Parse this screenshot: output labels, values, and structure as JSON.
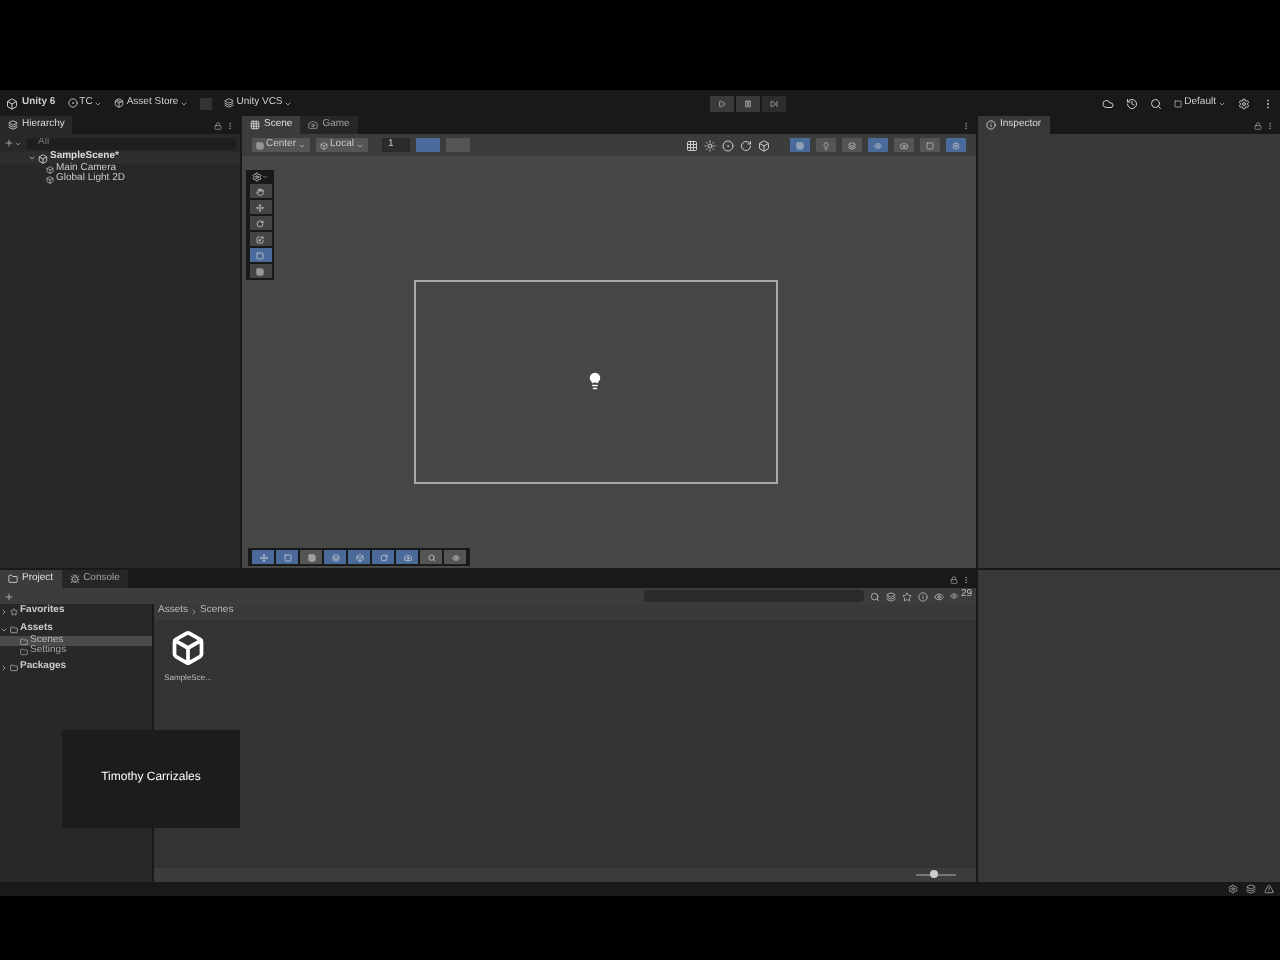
{
  "toolbar": {
    "account": "Unity 6",
    "cloud": "TC",
    "asset_store": "Asset Store",
    "vcs": "Unity VCS",
    "layout": "Default"
  },
  "hierarchy": {
    "tab": "Hierarchy",
    "search_placeholder": "All",
    "scene": {
      "name": "SampleScene*",
      "expanded": true,
      "children": [
        {
          "name": "Main Camera"
        },
        {
          "name": "Global Light 2D"
        }
      ]
    }
  },
  "scene_view": {
    "tabs": [
      {
        "label": "Scene",
        "selected": true
      },
      {
        "label": "Game",
        "selected": false
      }
    ],
    "pivot": "Center",
    "space": "Local",
    "grid_value": "1",
    "grid_toggle": {
      "on": true
    },
    "snap_toggle": {
      "on": false
    },
    "view_toggles": [
      {
        "on": true
      },
      {
        "on": false
      },
      {
        "on": false
      },
      {
        "on": true
      },
      {
        "on": false
      },
      {
        "on": false
      },
      {
        "on": true
      }
    ],
    "tools": [
      {
        "selected": false
      },
      {
        "selected": false
      },
      {
        "selected": false
      },
      {
        "selected": false
      },
      {
        "selected": true
      },
      {
        "selected": false
      }
    ],
    "overlay_tools": [
      {
        "selected": true
      },
      {
        "selected": true
      },
      {
        "selected": false
      },
      {
        "selected": true
      },
      {
        "selected": true
      },
      {
        "selected": true
      },
      {
        "selected": true
      },
      {
        "selected": false
      },
      {
        "selected": false
      }
    ]
  },
  "inspector": {
    "tab": "Inspector"
  },
  "project": {
    "tabs": [
      {
        "label": "Project",
        "selected": true
      },
      {
        "label": "Console",
        "selected": false
      }
    ],
    "tree": [
      {
        "name": "Favorites",
        "expanded": false,
        "selected": false
      },
      {
        "name": "Assets",
        "expanded": true,
        "selected": false,
        "children": [
          {
            "name": "Scenes",
            "selected": true
          },
          {
            "name": "Settings",
            "selected": false
          }
        ]
      },
      {
        "name": "Packages",
        "expanded": false,
        "selected": false
      }
    ],
    "breadcrumb": [
      "Assets",
      "Scenes"
    ],
    "items": [
      {
        "name": "SampleSce..."
      }
    ],
    "hidden_count": "29",
    "zoom": {
      "level": 0.45
    }
  },
  "caption": "Timothy Carrizales"
}
